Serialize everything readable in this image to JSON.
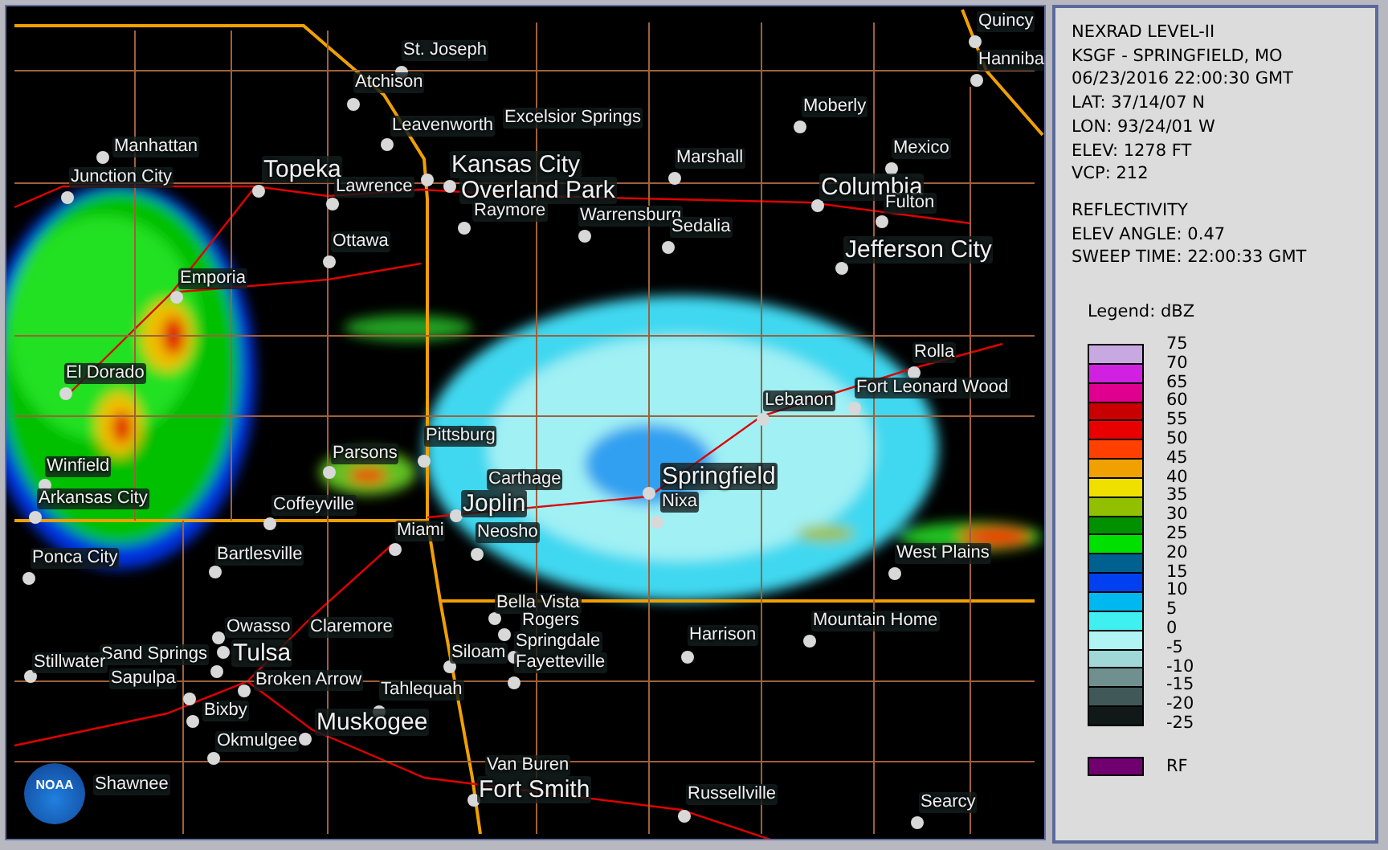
{
  "map": {
    "logo": {
      "text": "NOAA"
    },
    "cities": [
      {
        "name": "St. Joseph",
        "kind": "town"
      },
      {
        "name": "Atchison",
        "kind": "town"
      },
      {
        "name": "Leavenworth",
        "kind": "town"
      },
      {
        "name": "Excelsior Springs",
        "kind": "town"
      },
      {
        "name": "Kansas City",
        "kind": "major"
      },
      {
        "name": "Overland Park",
        "kind": "major"
      },
      {
        "name": "Raymore",
        "kind": "town"
      },
      {
        "name": "Manhattan",
        "kind": "town"
      },
      {
        "name": "Junction City",
        "kind": "town"
      },
      {
        "name": "Topeka",
        "kind": "major"
      },
      {
        "name": "Lawrence",
        "kind": "town"
      },
      {
        "name": "Ottawa",
        "kind": "town"
      },
      {
        "name": "Emporia",
        "kind": "town"
      },
      {
        "name": "Moberly",
        "kind": "town"
      },
      {
        "name": "Marshall",
        "kind": "town"
      },
      {
        "name": "Mexico",
        "kind": "town"
      },
      {
        "name": "Columbia",
        "kind": "major"
      },
      {
        "name": "Fulton",
        "kind": "town"
      },
      {
        "name": "Warrensburg",
        "kind": "town"
      },
      {
        "name": "Sedalia",
        "kind": "town"
      },
      {
        "name": "Jefferson City",
        "kind": "major"
      },
      {
        "name": "Quincy",
        "kind": "town"
      },
      {
        "name": "Hanniba",
        "kind": "town"
      },
      {
        "name": "El Dorado",
        "kind": "town"
      },
      {
        "name": "Winfield",
        "kind": "town"
      },
      {
        "name": "Arkansas City",
        "kind": "town"
      },
      {
        "name": "Ponca City",
        "kind": "town"
      },
      {
        "name": "Parsons",
        "kind": "town"
      },
      {
        "name": "Pittsburg",
        "kind": "town"
      },
      {
        "name": "Coffeyville",
        "kind": "town"
      },
      {
        "name": "Miami",
        "kind": "town"
      },
      {
        "name": "Bartlesville",
        "kind": "town"
      },
      {
        "name": "Carthage",
        "kind": "town"
      },
      {
        "name": "Joplin",
        "kind": "major"
      },
      {
        "name": "Neosho",
        "kind": "town"
      },
      {
        "name": "Springfield",
        "kind": "major"
      },
      {
        "name": "Nixa",
        "kind": "town"
      },
      {
        "name": "Lebanon",
        "kind": "town"
      },
      {
        "name": "Rolla",
        "kind": "town"
      },
      {
        "name": "Fort Leonard Wood",
        "kind": "town"
      },
      {
        "name": "West Plains",
        "kind": "town"
      },
      {
        "name": "Bella Vista",
        "kind": "town"
      },
      {
        "name": "Rogers",
        "kind": "town"
      },
      {
        "name": "Springdale",
        "kind": "town"
      },
      {
        "name": "Fayetteville",
        "kind": "town"
      },
      {
        "name": "Siloam",
        "kind": "town"
      },
      {
        "name": "Harrison",
        "kind": "town"
      },
      {
        "name": "Mountain Home",
        "kind": "town"
      },
      {
        "name": "Owasso",
        "kind": "town"
      },
      {
        "name": "Claremore",
        "kind": "town"
      },
      {
        "name": "Sand Springs",
        "kind": "town"
      },
      {
        "name": "Tulsa",
        "kind": "major"
      },
      {
        "name": "Broken Arrow",
        "kind": "town"
      },
      {
        "name": "Sapulpa",
        "kind": "town"
      },
      {
        "name": "Bixby",
        "kind": "town"
      },
      {
        "name": "Stillwater",
        "kind": "town"
      },
      {
        "name": "Tahlequah",
        "kind": "town"
      },
      {
        "name": "Muskogee",
        "kind": "major"
      },
      {
        "name": "Okmulgee",
        "kind": "town"
      },
      {
        "name": "Shawnee",
        "kind": "town"
      },
      {
        "name": "Van Buren",
        "kind": "town"
      },
      {
        "name": "Fort Smith",
        "kind": "major"
      },
      {
        "name": "Russellville",
        "kind": "town"
      },
      {
        "name": "Searcy",
        "kind": "town"
      }
    ]
  },
  "panel": {
    "station_lines": [
      "NEXRAD LEVEL-II",
      "KSGF - SPRINGFIELD, MO",
      "06/23/2016 22:00:30 GMT",
      "LAT: 37/14/07 N",
      "LON: 93/24/01 W",
      "ELEV: 1278 FT",
      "VCP: 212"
    ],
    "product_lines": [
      "REFLECTIVITY",
      "ELEV ANGLE: 0.47",
      "SWEEP TIME: 22:00:33 GMT"
    ],
    "legend": {
      "title": "Legend: dBZ",
      "scale": [
        {
          "label": "75",
          "color": "#c8a8e0"
        },
        {
          "label": "70",
          "color": "#d020e0"
        },
        {
          "label": "65",
          "color": "#e00090"
        },
        {
          "label": "60",
          "color": "#c80000"
        },
        {
          "label": "55",
          "color": "#e80000"
        },
        {
          "label": "50",
          "color": "#ff4000"
        },
        {
          "label": "45",
          "color": "#f0a000"
        },
        {
          "label": "40",
          "color": "#f0e000"
        },
        {
          "label": "35",
          "color": "#90c000"
        },
        {
          "label": "30",
          "color": "#009000"
        },
        {
          "label": "25",
          "color": "#00e000"
        },
        {
          "label": "20",
          "color": "#006090"
        },
        {
          "label": "15",
          "color": "#0040f0"
        },
        {
          "label": "10",
          "color": "#00b8f0"
        },
        {
          "label": "5",
          "color": "#40f0f0"
        },
        {
          "label": "0",
          "color": "#b0f4f4"
        },
        {
          "label": "-5",
          "color": "#a0d8d8"
        },
        {
          "label": "-10",
          "color": "#709090"
        },
        {
          "label": "-15",
          "color": "#405858"
        },
        {
          "label": "-20",
          "color": "#101818"
        },
        {
          "label": "-25"
        }
      ],
      "extra": {
        "label": "RF",
        "color": "#700070"
      }
    }
  }
}
